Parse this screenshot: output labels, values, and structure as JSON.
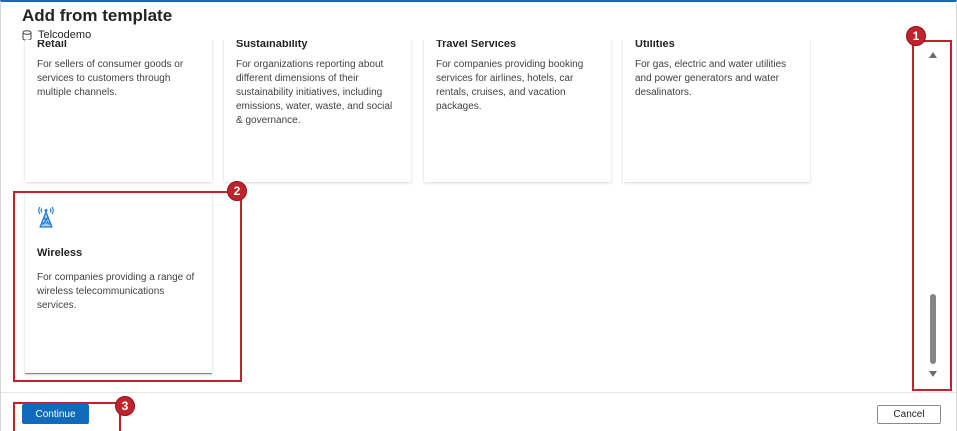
{
  "header": {
    "title": "Add from template",
    "subtitle": "Telcodemo",
    "subtitle_icon": "database-icon"
  },
  "templates": [
    {
      "title": "Retail",
      "description": "For sellers of consumer goods or services to customers through multiple channels."
    },
    {
      "title": "Sustainability",
      "description": "For organizations reporting about different dimensions of their sustainability initiatives, including emissions, water, waste, and social & governance."
    },
    {
      "title": "Travel Services",
      "description": "For companies providing booking services for airlines, hotels, car rentals, cruises, and vacation packages."
    },
    {
      "title": "Utilities",
      "description": "For gas, electric and water utilities and power generators and water desalinators."
    },
    {
      "title": "Wireless",
      "description": "For companies providing a range of wireless telecommunications services.",
      "icon": "cell-tower-icon",
      "selected": true
    }
  ],
  "footer": {
    "continue_label": "Continue",
    "cancel_label": "Cancel"
  },
  "annotations": {
    "badge_1": "1",
    "badge_2": "2",
    "badge_3": "3"
  },
  "colors": {
    "accent": "#0f6cbd",
    "annotation": "#c1232c",
    "tower_icon": "#1f78d1"
  }
}
